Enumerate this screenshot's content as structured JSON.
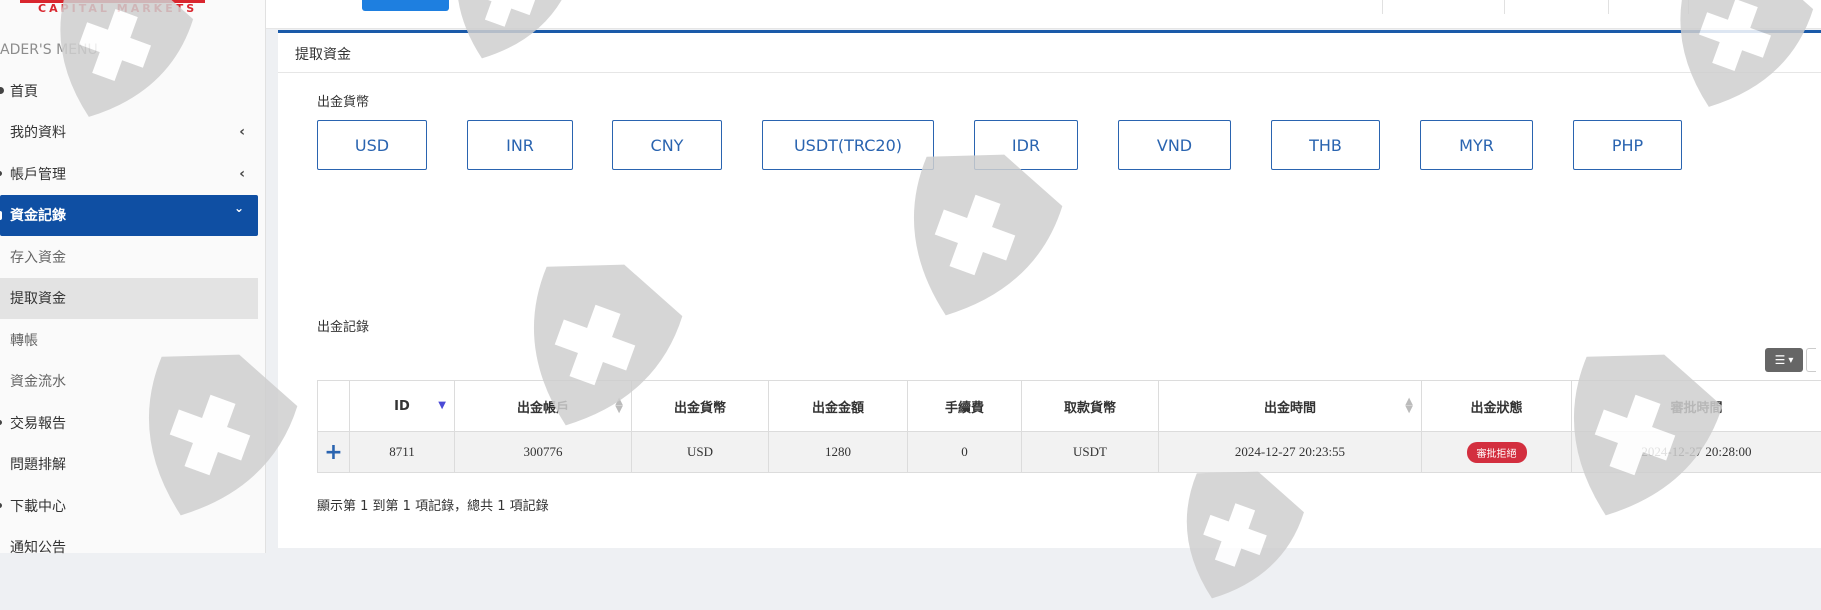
{
  "brand": {
    "name": "CAPITAL MARKETS"
  },
  "sidebar": {
    "header": "ADER'S MENU",
    "items": [
      {
        "label": "首頁"
      },
      {
        "label": "我的資料",
        "chevron": "‹"
      },
      {
        "label": "帳戶管理",
        "chevron": "‹"
      },
      {
        "label": "資金記錄",
        "chevron": "⌄"
      },
      {
        "label": "存入資金"
      },
      {
        "label": "提取資金"
      },
      {
        "label": "轉帳"
      },
      {
        "label": "資金流水"
      },
      {
        "label": "交易報告"
      },
      {
        "label": "問題排解"
      },
      {
        "label": "下載中心"
      },
      {
        "label": "通知公告"
      }
    ]
  },
  "panel": {
    "title": "提取資金",
    "currency_label": "出金貨幣",
    "currencies": [
      "USD",
      "INR",
      "CNY",
      "USDT(TRC20)",
      "IDR",
      "VND",
      "THB",
      "MYR",
      "PHP"
    ],
    "records_label": "出金記錄"
  },
  "table": {
    "headers": [
      "ID",
      "出金帳戶",
      "出金貨幣",
      "出金金額",
      "手續費",
      "取款貨幣",
      "出金時間",
      "出金狀態",
      "審批時間"
    ],
    "rows": [
      {
        "expand": "+",
        "id": "8711",
        "account": "300776",
        "currency": "USD",
        "amount": "1280",
        "fee": "0",
        "withdraw_currency": "USDT",
        "time": "2024-12-27 20:23:55",
        "status": "審批拒絕",
        "approve_time": "2024-12-27 20:28:00"
      }
    ],
    "footer": "顯示第 1 到第 1 項記錄，總共 1 項記錄"
  },
  "colors": {
    "accent": "#0f4fa3",
    "button_border": "#2a64b0",
    "status_rejected": "#d32f3f",
    "brand": "#d9262e"
  },
  "icons": [
    "shield-watermark-icon",
    "grid-icon",
    "caret-down-icon",
    "sort-icon",
    "plus-icon"
  ]
}
